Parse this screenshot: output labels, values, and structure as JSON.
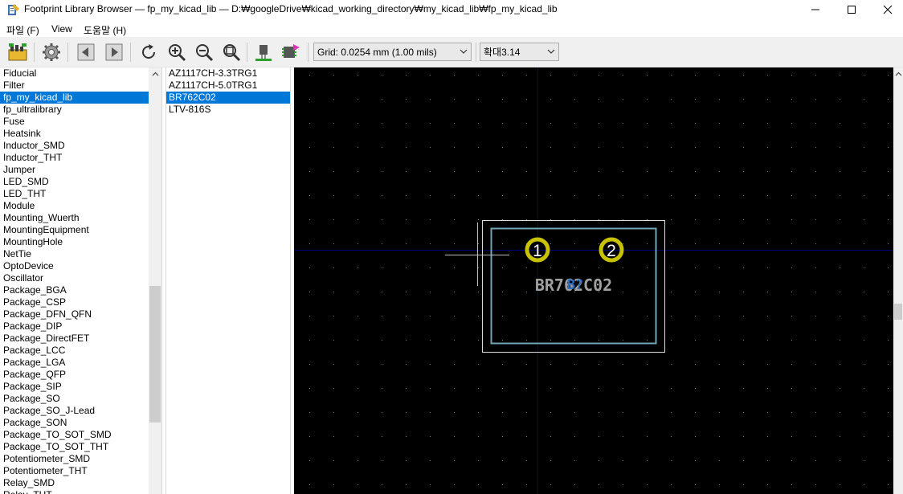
{
  "window": {
    "title": "Footprint Library Browser — fp_my_kicad_lib — D:₩googleDrive₩kicad_working_directory₩my_kicad_lib₩fp_my_kicad_lib"
  },
  "menu": {
    "file": "파일 (F)",
    "view": "View",
    "help": "도움말 (H)"
  },
  "toolbar": {
    "grid_select": "Grid: 0.0254 mm (1.00 mils)",
    "zoom_select": "확대3.14",
    "icons": [
      "open-library-icon",
      "settings-icon",
      "previous-footprint-icon",
      "next-footprint-icon",
      "redraw-icon",
      "zoom-in-icon",
      "zoom-out-icon",
      "zoom-fit-icon",
      "show-3d-icon",
      "insert-footprint-icon"
    ]
  },
  "libraries": {
    "selected_index": 2,
    "items": [
      "Fiducial",
      "Filter",
      "fp_my_kicad_lib",
      "fp_ultralibrary",
      "Fuse",
      "Heatsink",
      "Inductor_SMD",
      "Inductor_THT",
      "Jumper",
      "LED_SMD",
      "LED_THT",
      "Module",
      "Mounting_Wuerth",
      "MountingEquipment",
      "MountingHole",
      "NetTie",
      "OptoDevice",
      "Oscillator",
      "Package_BGA",
      "Package_CSP",
      "Package_DFN_QFN",
      "Package_DIP",
      "Package_DirectFET",
      "Package_LCC",
      "Package_LGA",
      "Package_QFP",
      "Package_SIP",
      "Package_SO",
      "Package_SO_J-Lead",
      "Package_SON",
      "Package_TO_SOT_SMD",
      "Package_TO_SOT_THT",
      "Potentiometer_SMD",
      "Potentiometer_THT",
      "Relay_SMD",
      "Relay_THT"
    ]
  },
  "footprints": {
    "selected_index": 2,
    "items": [
      "AZ1117CH-3.3TRG1",
      "AZ1117CH-5.0TRG1",
      "BR762C02",
      "LTV-816S"
    ]
  },
  "canvas": {
    "footprint_value": "BR762C02",
    "reference": "B?",
    "pad1": "1",
    "pad2": "2",
    "colors": {
      "background": "#000000",
      "grid_dot": "#7a7a7a",
      "axis": "#00007a",
      "pad": "#c8c200",
      "courtyard": "#dcdcdc",
      "fab": "#6fa8b4",
      "value_text": "#a0a0a0",
      "ref_text": "#2b6fc2"
    }
  }
}
